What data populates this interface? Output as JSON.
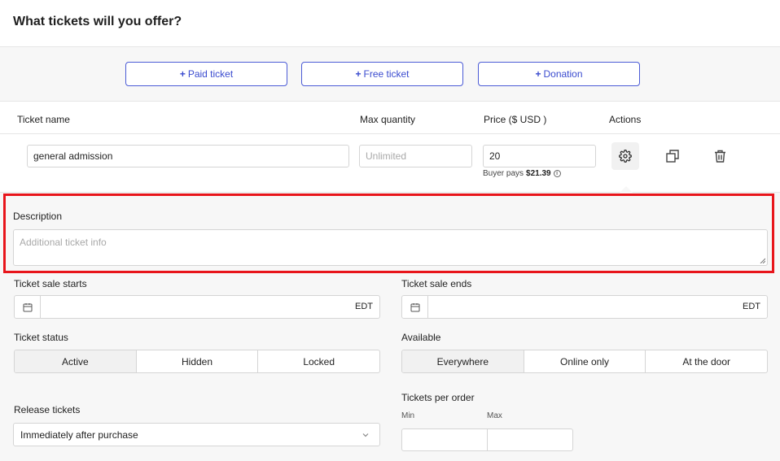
{
  "header": {
    "title": "What tickets will you offer?"
  },
  "add_buttons": [
    {
      "label": "Paid ticket"
    },
    {
      "label": "Free ticket"
    },
    {
      "label": "Donation"
    }
  ],
  "columns": {
    "ticket_name": "Ticket name",
    "max_quantity": "Max quantity",
    "price": "Price ($ USD )",
    "actions": "Actions"
  },
  "ticket": {
    "name": "general admission",
    "max_quantity_placeholder": "Unlimited",
    "price": "20",
    "buyer_pays_label": "Buyer pays",
    "buyer_pays_amount": "$21.39"
  },
  "settings": {
    "description_label": "Description",
    "description_placeholder": "Additional ticket info",
    "sale_starts_label": "Ticket sale starts",
    "sale_ends_label": "Ticket sale ends",
    "timezone": "EDT",
    "status_label": "Ticket status",
    "status_options": [
      "Active",
      "Hidden",
      "Locked"
    ],
    "status_selected": "Active",
    "available_label": "Available",
    "available_options": [
      "Everywhere",
      "Online only",
      "At the door"
    ],
    "available_selected": "Everywhere",
    "release_label": "Release tickets",
    "release_value": "Immediately after purchase",
    "per_order_label": "Tickets per order",
    "min_label": "Min",
    "max_label": "Max"
  },
  "colors": {
    "accent": "#3a4bcf",
    "highlight": "#e8151b",
    "panel": "#f7f7f7"
  }
}
